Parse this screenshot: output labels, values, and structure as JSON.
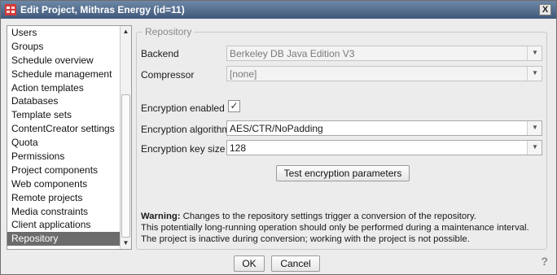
{
  "window": {
    "title": "Edit Project, Mithras Energy (id=11)",
    "close_label": "X"
  },
  "sidebar": {
    "items": [
      "Users",
      "Groups",
      "Schedule overview",
      "Schedule management",
      "Action templates",
      "Databases",
      "Template sets",
      "ContentCreator settings",
      "Quota",
      "Permissions",
      "Project components",
      "Web components",
      "Remote projects",
      "Media constraints",
      "Client applications",
      "Repository"
    ],
    "selected": "Repository"
  },
  "repository": {
    "legend": "Repository",
    "backend_label": "Backend",
    "backend_value": "Berkeley DB Java Edition V3",
    "compressor_label": "Compressor",
    "compressor_value": "[none]",
    "encryption_enabled_label": "Encryption enabled",
    "encryption_enabled_checked": true,
    "encryption_algorithm_label": "Encryption algorithm",
    "encryption_algorithm_value": "AES/CTR/NoPadding",
    "encryption_key_size_label": "Encryption key size",
    "encryption_key_size_value": "128",
    "test_button": "Test encryption parameters",
    "warning_title": "Warning:",
    "warning_line1": " Changes to the repository settings trigger a conversion of the repository.",
    "warning_line2": "This potentially long-running operation should only be performed during a maintenance interval.",
    "warning_line3": "The project is inactive during conversion; working with the project is not possible."
  },
  "footer": {
    "ok": "OK",
    "cancel": "Cancel",
    "help": "?"
  },
  "icons": {
    "window": "project-icon",
    "check": "checkmark-icon",
    "dropdown": "chevron-down-icon"
  },
  "colors": {
    "titlebar": "#4b6484",
    "selection": "#6c6c6c"
  }
}
